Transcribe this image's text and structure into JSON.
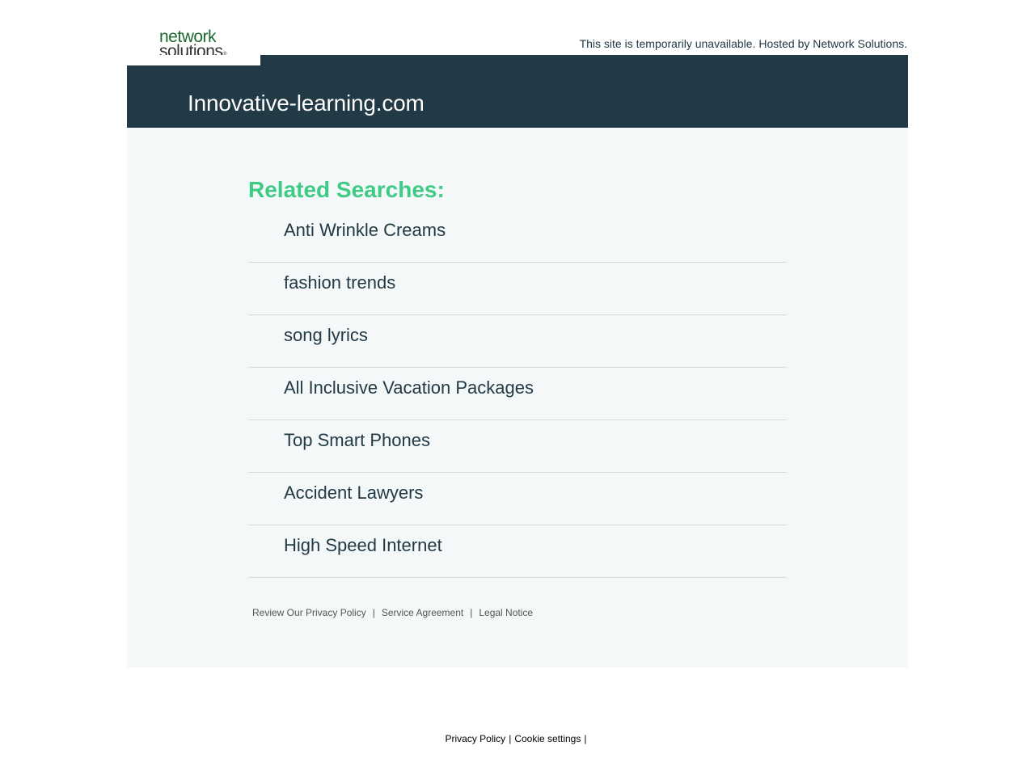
{
  "header": {
    "logo_line1": "network",
    "logo_line2": "solutions",
    "logo_mark": "®",
    "hosted_note": "This site is temporarily unavailable. Hosted by Network Solutions."
  },
  "banner": {
    "domain": "Innovative-learning.com"
  },
  "related": {
    "heading": "Related Searches:",
    "items": [
      {
        "label": "Anti Wrinkle Creams"
      },
      {
        "label": "fashion trends"
      },
      {
        "label": "song lyrics"
      },
      {
        "label": "All Inclusive Vacation Packages"
      },
      {
        "label": "Top Smart Phones"
      },
      {
        "label": "Accident Lawyers"
      },
      {
        "label": "High Speed Internet"
      }
    ]
  },
  "legal": {
    "privacy": "Review Our Privacy Policy",
    "service": "Service Agreement",
    "notice": "Legal Notice",
    "separator": "|"
  },
  "footer": {
    "privacy": "Privacy Policy",
    "cookies": "Cookie settings",
    "separator": "|"
  },
  "colors": {
    "banner_bg": "#223946",
    "heading_green": "#3fcb85",
    "content_bg": "#f4f8f8",
    "logo_green": "#1d6b2e"
  }
}
